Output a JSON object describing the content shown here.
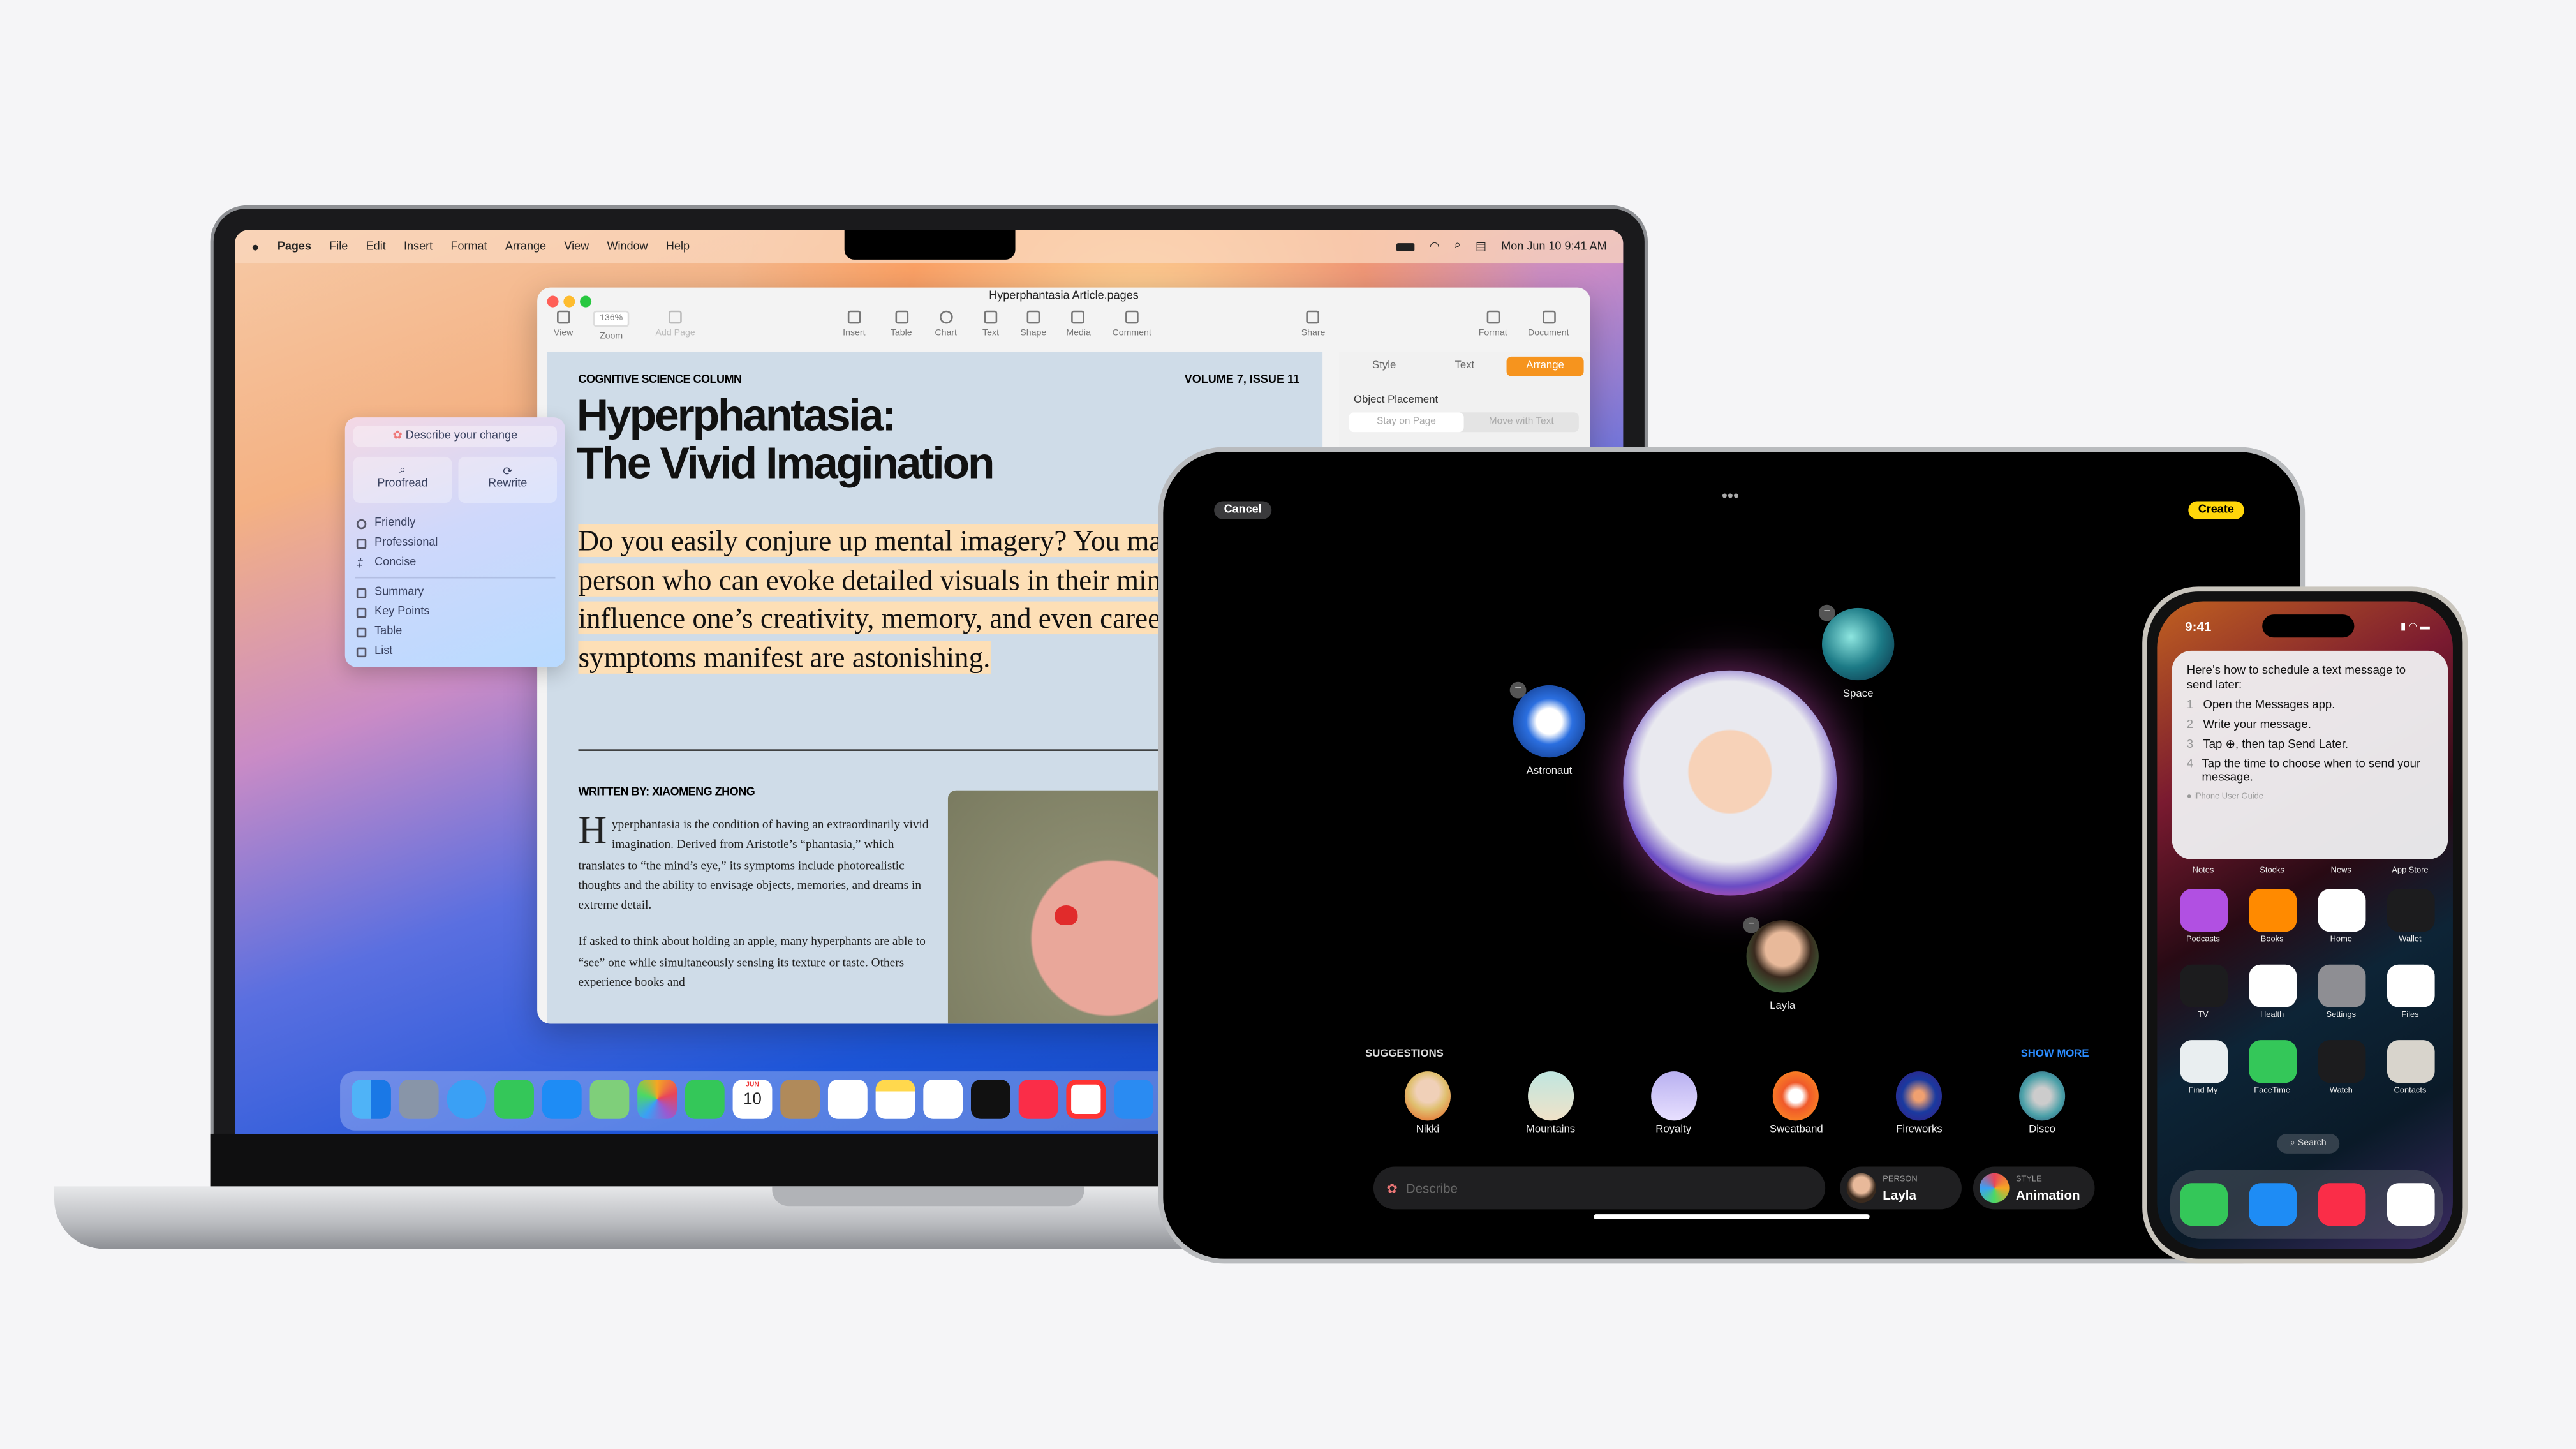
{
  "mac": {
    "menubar": {
      "app": "Pages",
      "items": [
        "File",
        "Edit",
        "Insert",
        "Format",
        "Arrange",
        "View",
        "Window",
        "Help"
      ],
      "clock": "Mon Jun 10  9:41 AM"
    },
    "window": {
      "title": "Hyperphantasia Article.pages",
      "toolbar": {
        "view": "View",
        "zoom_value": "136%",
        "zoom": "Zoom",
        "add_page": "Add Page",
        "insert": "Insert",
        "table": "Table",
        "chart": "Chart",
        "text": "Text",
        "shape": "Shape",
        "media": "Media",
        "comment": "Comment",
        "share": "Share",
        "format": "Format",
        "document": "Document"
      },
      "sidebar": {
        "tabs": [
          "Style",
          "Text",
          "Arrange"
        ],
        "active_tab": "Arrange",
        "section": "Object Placement",
        "options": [
          "Stay on Page",
          "Move with Text"
        ]
      },
      "doc": {
        "column": "COGNITIVE SCIENCE COLUMN",
        "volume": "VOLUME 7, ISSUE 11",
        "title_line1": "Hyperphantasia:",
        "title_line2": "The Vivid Imagination",
        "lede": "Do you easily conjure up mental imagery? You may be a hyperphant, a person who can evoke detailed visuals in their mind. This condition can influence one’s creativity, memory, and even career. The ways that symptoms manifest are astonishing.",
        "byline": "WRITTEN BY: XIAOMENG ZHONG",
        "dropcap": "H",
        "para1": "yperphantasia is the condition of having an extraordinarily vivid imagination. Derived from Aristotle’s “phantasia,” which translates to “the mind’s eye,” its symptoms include photorealistic thoughts and the ability to envisage objects, memories, and dreams in extreme detail.",
        "para2": "If asked to think about holding an apple, many hyperphants are able to “see” one while simultaneously sensing its texture or taste. Others experience books and"
      }
    },
    "writing_tools": {
      "describe": "Describe your change",
      "proofread": "Proofread",
      "rewrite": "Rewrite",
      "tones": [
        "Friendly",
        "Professional",
        "Concise"
      ],
      "formats": [
        "Summary",
        "Key Points",
        "Table",
        "List"
      ]
    },
    "dock_apps": [
      "Finder",
      "Launchpad",
      "Safari",
      "Messages",
      "Mail",
      "Maps",
      "Photos",
      "FaceTime",
      "Calendar",
      "Contacts",
      "Reminders",
      "Notes",
      "Freeform",
      "TV",
      "Music",
      "News",
      "Keynote"
    ],
    "calendar_icon": {
      "month": "JUN",
      "day": "10"
    }
  },
  "ipad": {
    "cancel": "Cancel",
    "create": "Create",
    "accent": "#ffd60a",
    "bubbles": [
      "Astronaut",
      "Space",
      "Layla"
    ],
    "suggestions_title": "SUGGESTIONS",
    "show_more": "SHOW MORE",
    "suggestions": [
      "Nikki",
      "Mountains",
      "Royalty",
      "Sweatband",
      "Fireworks",
      "Disco"
    ],
    "describe_placeholder": "Describe",
    "person": {
      "label": "PERSON",
      "value": "Layla"
    },
    "style": {
      "label": "STYLE",
      "value": "Animation"
    }
  },
  "iphone": {
    "time": "9:41",
    "siri": {
      "intro": "Here’s how to schedule a text message to send later:",
      "steps": [
        {
          "n": "1",
          "t": "Open the Messages app."
        },
        {
          "n": "2",
          "t": "Write your message."
        },
        {
          "n": "3",
          "t": "Tap ⊕, then tap Send Later."
        },
        {
          "n": "4",
          "t": "Tap the time to choose when to send your message."
        }
      ],
      "source": "iPhone User Guide"
    },
    "top_row": [
      "Notes",
      "Stocks",
      "News",
      "App Store"
    ],
    "apps": [
      {
        "name": "Podcasts",
        "color": "#b150e2"
      },
      {
        "name": "Books",
        "color": "#ff8a00"
      },
      {
        "name": "Home",
        "color": "#ffffff"
      },
      {
        "name": "Wallet",
        "color": "#1c1c1e"
      },
      {
        "name": "TV",
        "color": "#1c1c1e"
      },
      {
        "name": "Health",
        "color": "#ffffff"
      },
      {
        "name": "Settings",
        "color": "#8e8e93"
      },
      {
        "name": "Files",
        "color": "#ffffff"
      },
      {
        "name": "Find My",
        "color": "#e9eef0"
      },
      {
        "name": "FaceTime",
        "color": "#34c759"
      },
      {
        "name": "Watch",
        "color": "#1c1c1e"
      },
      {
        "name": "Contacts",
        "color": "#d8d4cc"
      }
    ],
    "search": "Search",
    "dock": [
      {
        "name": "Phone",
        "color": "#34c759"
      },
      {
        "name": "Mail",
        "color": "#1e8cf5"
      },
      {
        "name": "Music",
        "color": "#fa2d48"
      },
      {
        "name": "Safari",
        "color": "#ffffff"
      }
    ]
  }
}
